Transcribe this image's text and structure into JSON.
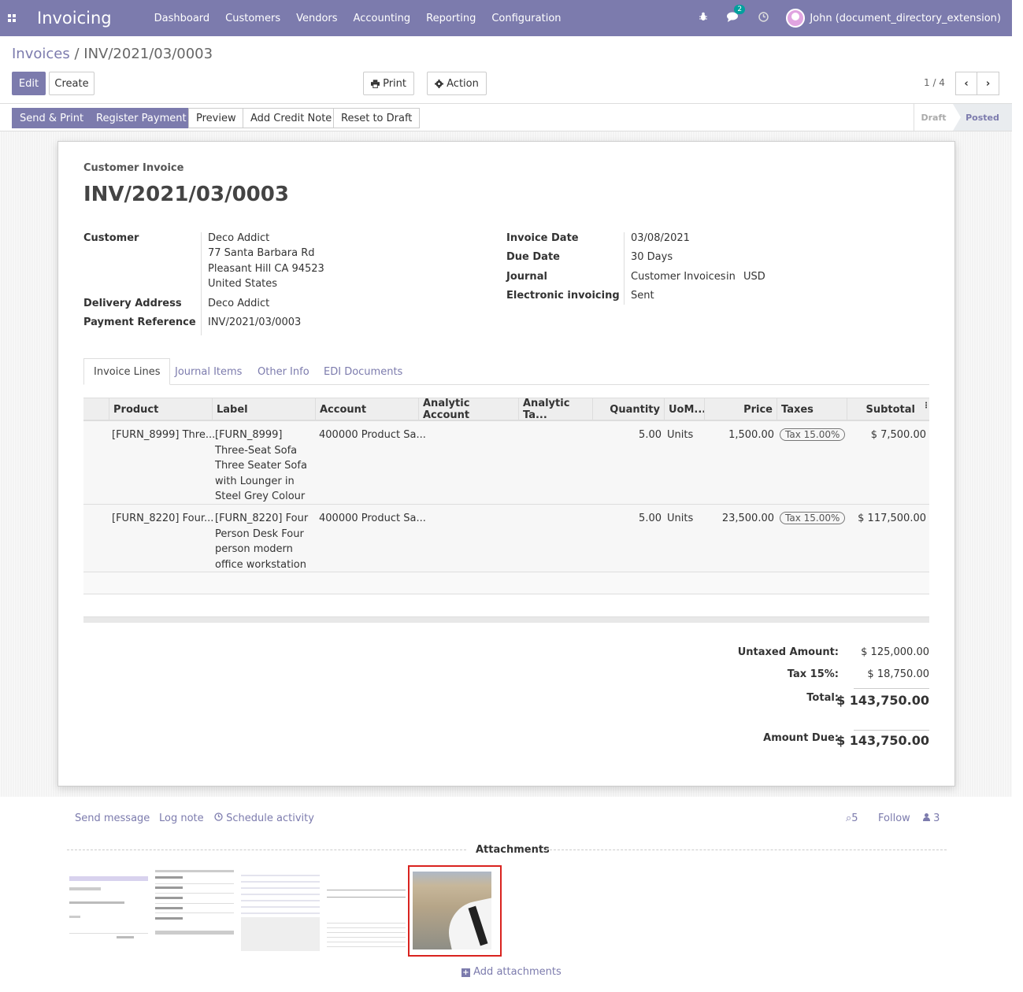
{
  "navbar": {
    "app_title": "Invoicing",
    "menu": [
      "Dashboard",
      "Customers",
      "Vendors",
      "Accounting",
      "Reporting",
      "Configuration"
    ],
    "message_count": "2",
    "user_name": "John (document_directory_extension)"
  },
  "breadcrumb": {
    "parent": "Invoices",
    "separator": "/",
    "current": "INV/2021/03/0003"
  },
  "buttons": {
    "edit": "Edit",
    "create": "Create",
    "print": "Print",
    "action": "Action"
  },
  "pager": {
    "value": "1 / 4"
  },
  "statusbar": {
    "send_print": "Send & Print",
    "register_payment": "Register Payment",
    "preview": "Preview",
    "add_credit_note": "Add Credit Note",
    "reset_to_draft": "Reset to Draft",
    "stages": [
      "Draft",
      "Posted"
    ],
    "current_stage": "Posted"
  },
  "invoice": {
    "type": "Customer Invoice",
    "name": "INV/2021/03/0003",
    "customer_label": "Customer",
    "customer_name": "Deco Addict",
    "address": [
      "77 Santa Barbara Rd",
      "Pleasant Hill CA 94523",
      "United States"
    ],
    "delivery_label": "Delivery Address",
    "delivery_value": "Deco Addict",
    "payment_ref_label": "Payment Reference",
    "payment_ref_value": "INV/2021/03/0003",
    "invoice_date_label": "Invoice Date",
    "invoice_date_value": "03/08/2021",
    "due_date_label": "Due Date",
    "due_date_value": "30 Days",
    "journal_label": "Journal",
    "journal_value": "Customer Invoices",
    "journal_in": "in",
    "currency": "USD",
    "edi_label": "Electronic invoicing",
    "edi_value": "Sent"
  },
  "tabs": [
    "Invoice Lines",
    "Journal Items",
    "Other Info",
    "EDI Documents"
  ],
  "lines": {
    "headers": [
      "Product",
      "Label",
      "Account",
      "Analytic Account",
      "Analytic Ta...",
      "Quantity",
      "UoM...",
      "Price",
      "Taxes",
      "Subtotal"
    ],
    "rows": [
      {
        "product": "[FURN_8999] Thre...",
        "label": "[FURN_8999] Three-Seat Sofa Three Seater Sofa with Lounger in Steel Grey Colour",
        "account": "400000 Product Sa...",
        "quantity": "5.00",
        "uom": "Units",
        "price": "1,500.00",
        "tax": "Tax 15.00%",
        "subtotal": "$ 7,500.00"
      },
      {
        "product": "[FURN_8220] Four...",
        "label": "[FURN_8220] Four Person Desk Four person modern office workstation",
        "account": "400000 Product Sa...",
        "quantity": "5.00",
        "uom": "Units",
        "price": "23,500.00",
        "tax": "Tax 15.00%",
        "subtotal": "$ 117,500.00"
      }
    ]
  },
  "totals": {
    "untaxed_label": "Untaxed Amount:",
    "untaxed_value": "$ 125,000.00",
    "tax_label": "Tax 15%:",
    "tax_value": "$ 18,750.00",
    "total_label": "Total:",
    "total_value": "$ 143,750.00",
    "due_label": "Amount Due:",
    "due_value": "$ 143,750.00"
  },
  "chatter": {
    "send_message": "Send message",
    "log_note": "Log note",
    "schedule_activity": "Schedule activity",
    "attachments_count": "5",
    "follow": "Follow",
    "followers_count": "3",
    "attachments_title": "Attachments",
    "add_attachments": "Add attachments"
  },
  "accent_color": "#7c7bad",
  "icons": [
    "apps-grid-icon",
    "bug-icon",
    "chat-icon",
    "clock-icon",
    "print-icon",
    "gear-icon",
    "chevron-left-icon",
    "chevron-right-icon",
    "paperclip-icon",
    "user-icon",
    "plus-square-icon"
  ]
}
